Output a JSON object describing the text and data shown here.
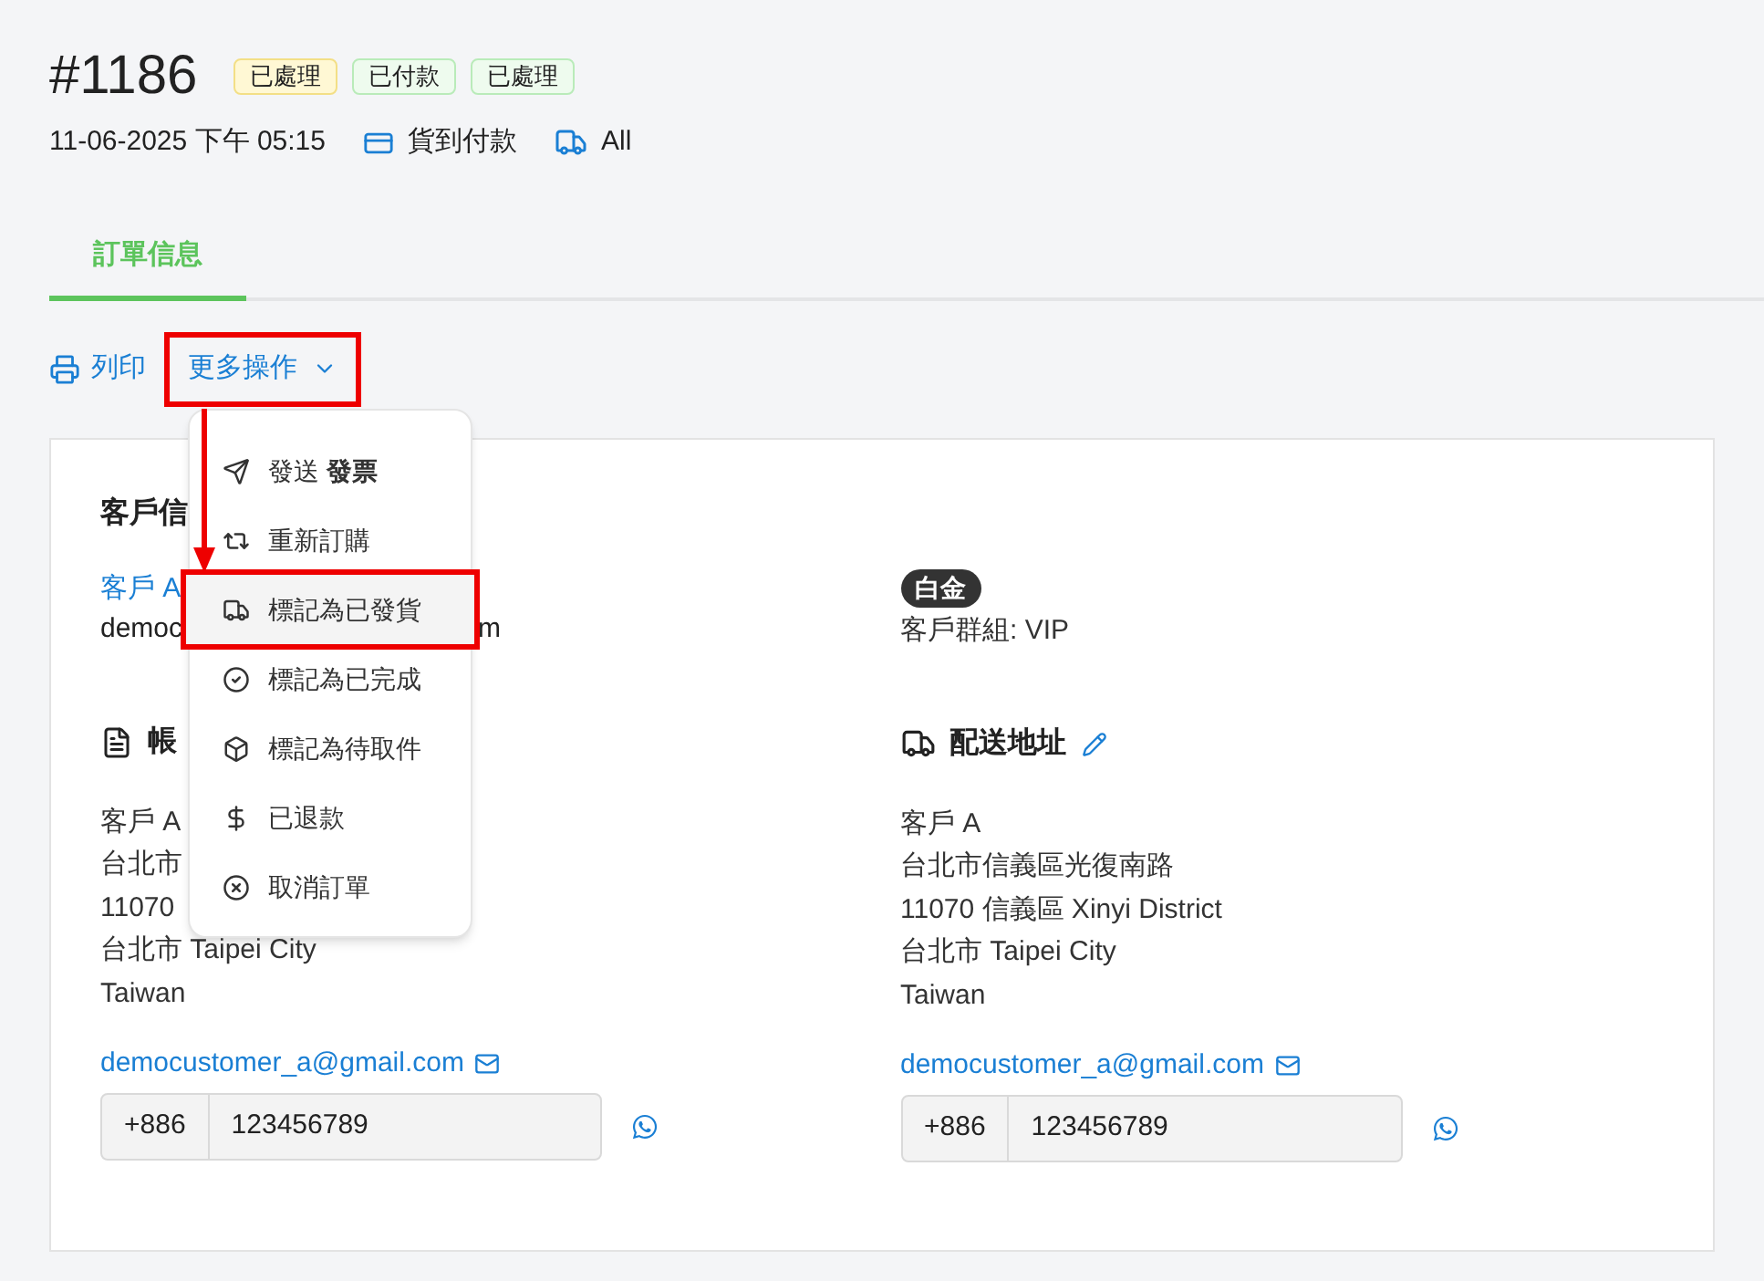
{
  "order": {
    "number": "#1186",
    "badges": [
      {
        "label": "已處理",
        "kind": "warning"
      },
      {
        "label": "已付款",
        "kind": "success"
      },
      {
        "label": "已處理",
        "kind": "success"
      }
    ],
    "date": "11-06-2025 下午 05:15",
    "payment": "貨到付款",
    "shipping_method": "All"
  },
  "tabs": [
    {
      "label": "訂單信息",
      "selected": true
    }
  ],
  "actions": {
    "print": "列印",
    "more": "更多操作"
  },
  "menu": {
    "items": [
      {
        "label": "發送 **發票**",
        "selected": false
      },
      {
        "label": "重新訂購",
        "selected": false
      },
      {
        "label": "標記為已發貨",
        "selected": true
      },
      {
        "label": "標記為已完成",
        "selected": false
      },
      {
        "label": "標記為待取件",
        "selected": false
      },
      {
        "label": "已退款",
        "selected": false
      },
      {
        "label": "取消訂單",
        "selected": false
      }
    ]
  },
  "customer": {
    "title": "客戶信",
    "name": "客戶 A",
    "email_parts": [
      "democ",
      "m"
    ],
    "tier": "白金",
    "group": "客戶群組: VIP"
  },
  "billing": {
    "title": "帳",
    "lines": [
      "客戶 A",
      "台北市",
      "11070",
      "台北市 Taipei City",
      "Taiwan"
    ],
    "email": "democustomer_a@gmail.com",
    "phone": {
      "code": "+886",
      "number": "123456789"
    }
  },
  "shipping": {
    "title": "配送地址",
    "lines": [
      "客戶 A",
      "台北市信義區光復南路",
      "11070 信義區 Xinyi District",
      "台北市 Taipei City",
      "Taiwan"
    ],
    "email": "democustomer_a@gmail.com",
    "phone": {
      "code": "+886",
      "number": "123456789"
    }
  }
}
